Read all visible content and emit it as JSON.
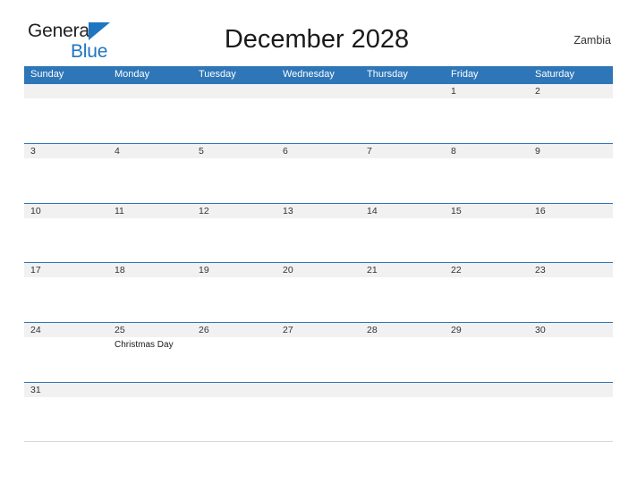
{
  "brand": {
    "name_part1": "General",
    "name_part2": "Blue",
    "triangle_color": "#1f76c0",
    "text_color": "#231f20"
  },
  "header": {
    "title": "December 2028",
    "country": "Zambia"
  },
  "theme": {
    "header_blue": "#2e76b8",
    "row_band_gray": "#f1f1f1",
    "date_text": "#333333"
  },
  "calendar": {
    "month": "December",
    "year": "2028",
    "weekday_headers": [
      "Sunday",
      "Monday",
      "Tuesday",
      "Wednesday",
      "Thursday",
      "Friday",
      "Saturday"
    ],
    "weeks": [
      {
        "days": [
          {
            "date": "",
            "event": ""
          },
          {
            "date": "",
            "event": ""
          },
          {
            "date": "",
            "event": ""
          },
          {
            "date": "",
            "event": ""
          },
          {
            "date": "",
            "event": ""
          },
          {
            "date": "1",
            "event": ""
          },
          {
            "date": "2",
            "event": ""
          }
        ]
      },
      {
        "days": [
          {
            "date": "3",
            "event": ""
          },
          {
            "date": "4",
            "event": ""
          },
          {
            "date": "5",
            "event": ""
          },
          {
            "date": "6",
            "event": ""
          },
          {
            "date": "7",
            "event": ""
          },
          {
            "date": "8",
            "event": ""
          },
          {
            "date": "9",
            "event": ""
          }
        ]
      },
      {
        "days": [
          {
            "date": "10",
            "event": ""
          },
          {
            "date": "11",
            "event": ""
          },
          {
            "date": "12",
            "event": ""
          },
          {
            "date": "13",
            "event": ""
          },
          {
            "date": "14",
            "event": ""
          },
          {
            "date": "15",
            "event": ""
          },
          {
            "date": "16",
            "event": ""
          }
        ]
      },
      {
        "days": [
          {
            "date": "17",
            "event": ""
          },
          {
            "date": "18",
            "event": ""
          },
          {
            "date": "19",
            "event": ""
          },
          {
            "date": "20",
            "event": ""
          },
          {
            "date": "21",
            "event": ""
          },
          {
            "date": "22",
            "event": ""
          },
          {
            "date": "23",
            "event": ""
          }
        ]
      },
      {
        "days": [
          {
            "date": "24",
            "event": ""
          },
          {
            "date": "25",
            "event": "Christmas Day"
          },
          {
            "date": "26",
            "event": ""
          },
          {
            "date": "27",
            "event": ""
          },
          {
            "date": "28",
            "event": ""
          },
          {
            "date": "29",
            "event": ""
          },
          {
            "date": "30",
            "event": ""
          }
        ]
      },
      {
        "days": [
          {
            "date": "31",
            "event": ""
          },
          {
            "date": "",
            "event": ""
          },
          {
            "date": "",
            "event": ""
          },
          {
            "date": "",
            "event": ""
          },
          {
            "date": "",
            "event": ""
          },
          {
            "date": "",
            "event": ""
          },
          {
            "date": "",
            "event": ""
          }
        ]
      }
    ]
  }
}
